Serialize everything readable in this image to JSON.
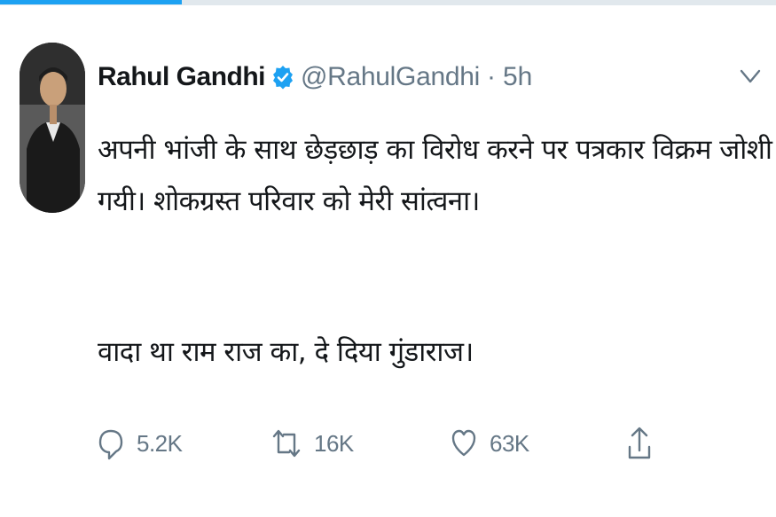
{
  "colors": {
    "accent": "#1da1f2",
    "text": "#14171a",
    "muted": "#657786",
    "divider": "#e1e8ed"
  },
  "tweet": {
    "author_name": "Rahul Gandhi",
    "handle": "@RahulGandhi",
    "separator": "·",
    "timestamp": "5h",
    "verified": true,
    "text_line_1": "अपनी भांजी के साथ छेड़छाड़ का विरोध करने पर पत्रकार विक्रम जोशी की हत्या कर दी",
    "text_line_2": "गयी। शोकग्रस्त परिवार को मेरी सांत्वना।",
    "text_line_3": "वादा था राम राज का, दे दिया गुंडाराज।"
  },
  "actions": {
    "reply": {
      "icon": "reply-icon",
      "count": "5.2K"
    },
    "retweet": {
      "icon": "retweet-icon",
      "count": "16K"
    },
    "like": {
      "icon": "heart-icon",
      "count": "63K"
    },
    "share": {
      "icon": "share-icon"
    }
  },
  "menu": {
    "icon": "chevron-down-icon"
  }
}
